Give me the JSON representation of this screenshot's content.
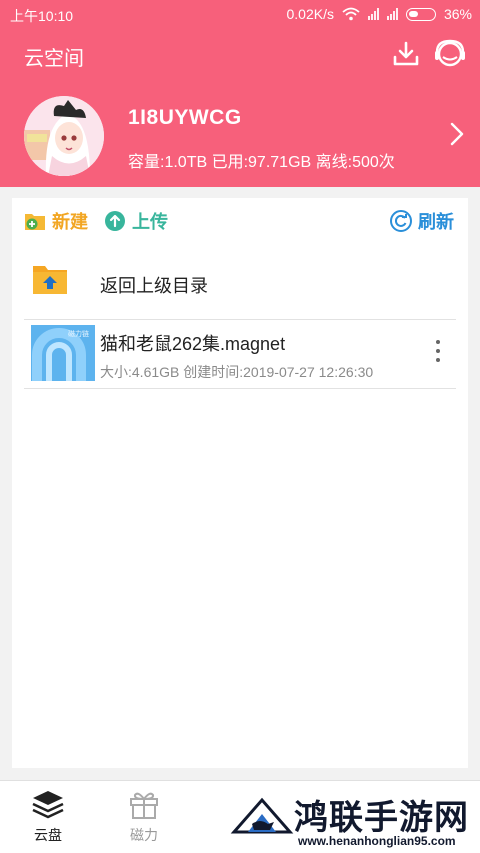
{
  "status_bar": {
    "time": "上午10:10",
    "speed": "0.02K/s",
    "battery": "36%"
  },
  "app_bar": {
    "title": "云空间",
    "download_icon": "download-icon",
    "support_icon": "headset-icon"
  },
  "profile": {
    "username": "1I8UYWCG",
    "quota": "容量:1.0TB 已用:97.71GB 离线:500次"
  },
  "toolbar": {
    "new_label": "新建",
    "upload_label": "上传",
    "refresh_label": "刷新"
  },
  "list": {
    "back_label": "返回上级目录",
    "files": [
      {
        "name": "猫和老鼠262集.magnet",
        "meta": "大小:4.61GB 创建时间:2019-07-27 12:26:30",
        "thumb_tag": "磁力链"
      }
    ]
  },
  "bottom_nav": {
    "items": [
      {
        "label": "云盘"
      },
      {
        "label": "磁力"
      }
    ]
  },
  "watermark": {
    "title": "鸿联手游网",
    "url": "www.henanhonglian95.com"
  },
  "colors": {
    "header": "#f7607b",
    "new": "#f2a623",
    "upload": "#38b59c",
    "refresh": "#2a8fd9"
  }
}
